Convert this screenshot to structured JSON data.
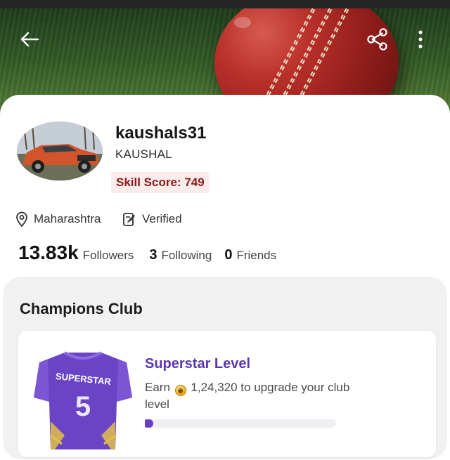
{
  "profile": {
    "username": "kaushals31",
    "full_name": "KAUSHAL",
    "skill_score_label": "Skill Score: 749",
    "location": "Maharashtra",
    "verified_label": "Verified"
  },
  "stats": {
    "followers_count": "13.83k",
    "followers_label": "Followers",
    "following_count": "3",
    "following_label": "Following",
    "friends_count": "0",
    "friends_label": "Friends"
  },
  "club": {
    "title": "Champions Club",
    "level_title": "Superstar Level",
    "earn_prefix": "Earn",
    "earn_amount": "1,24,320 to upgrade your club level",
    "jersey_text": "SUPERSTAR",
    "jersey_number": "5",
    "progress_fraction": 0.02
  },
  "icons": {
    "back": "back-arrow-icon",
    "share": "share-icon",
    "more": "more-vertical-icon",
    "location": "location-pin-icon",
    "verified": "verified-clipboard-icon",
    "coin": "coin-icon"
  },
  "colors": {
    "accent_purple": "#5b35b0",
    "skill_text": "#8a1a1a",
    "skill_bg": "#fbecec",
    "progress_fill": "#6a3fc9"
  }
}
